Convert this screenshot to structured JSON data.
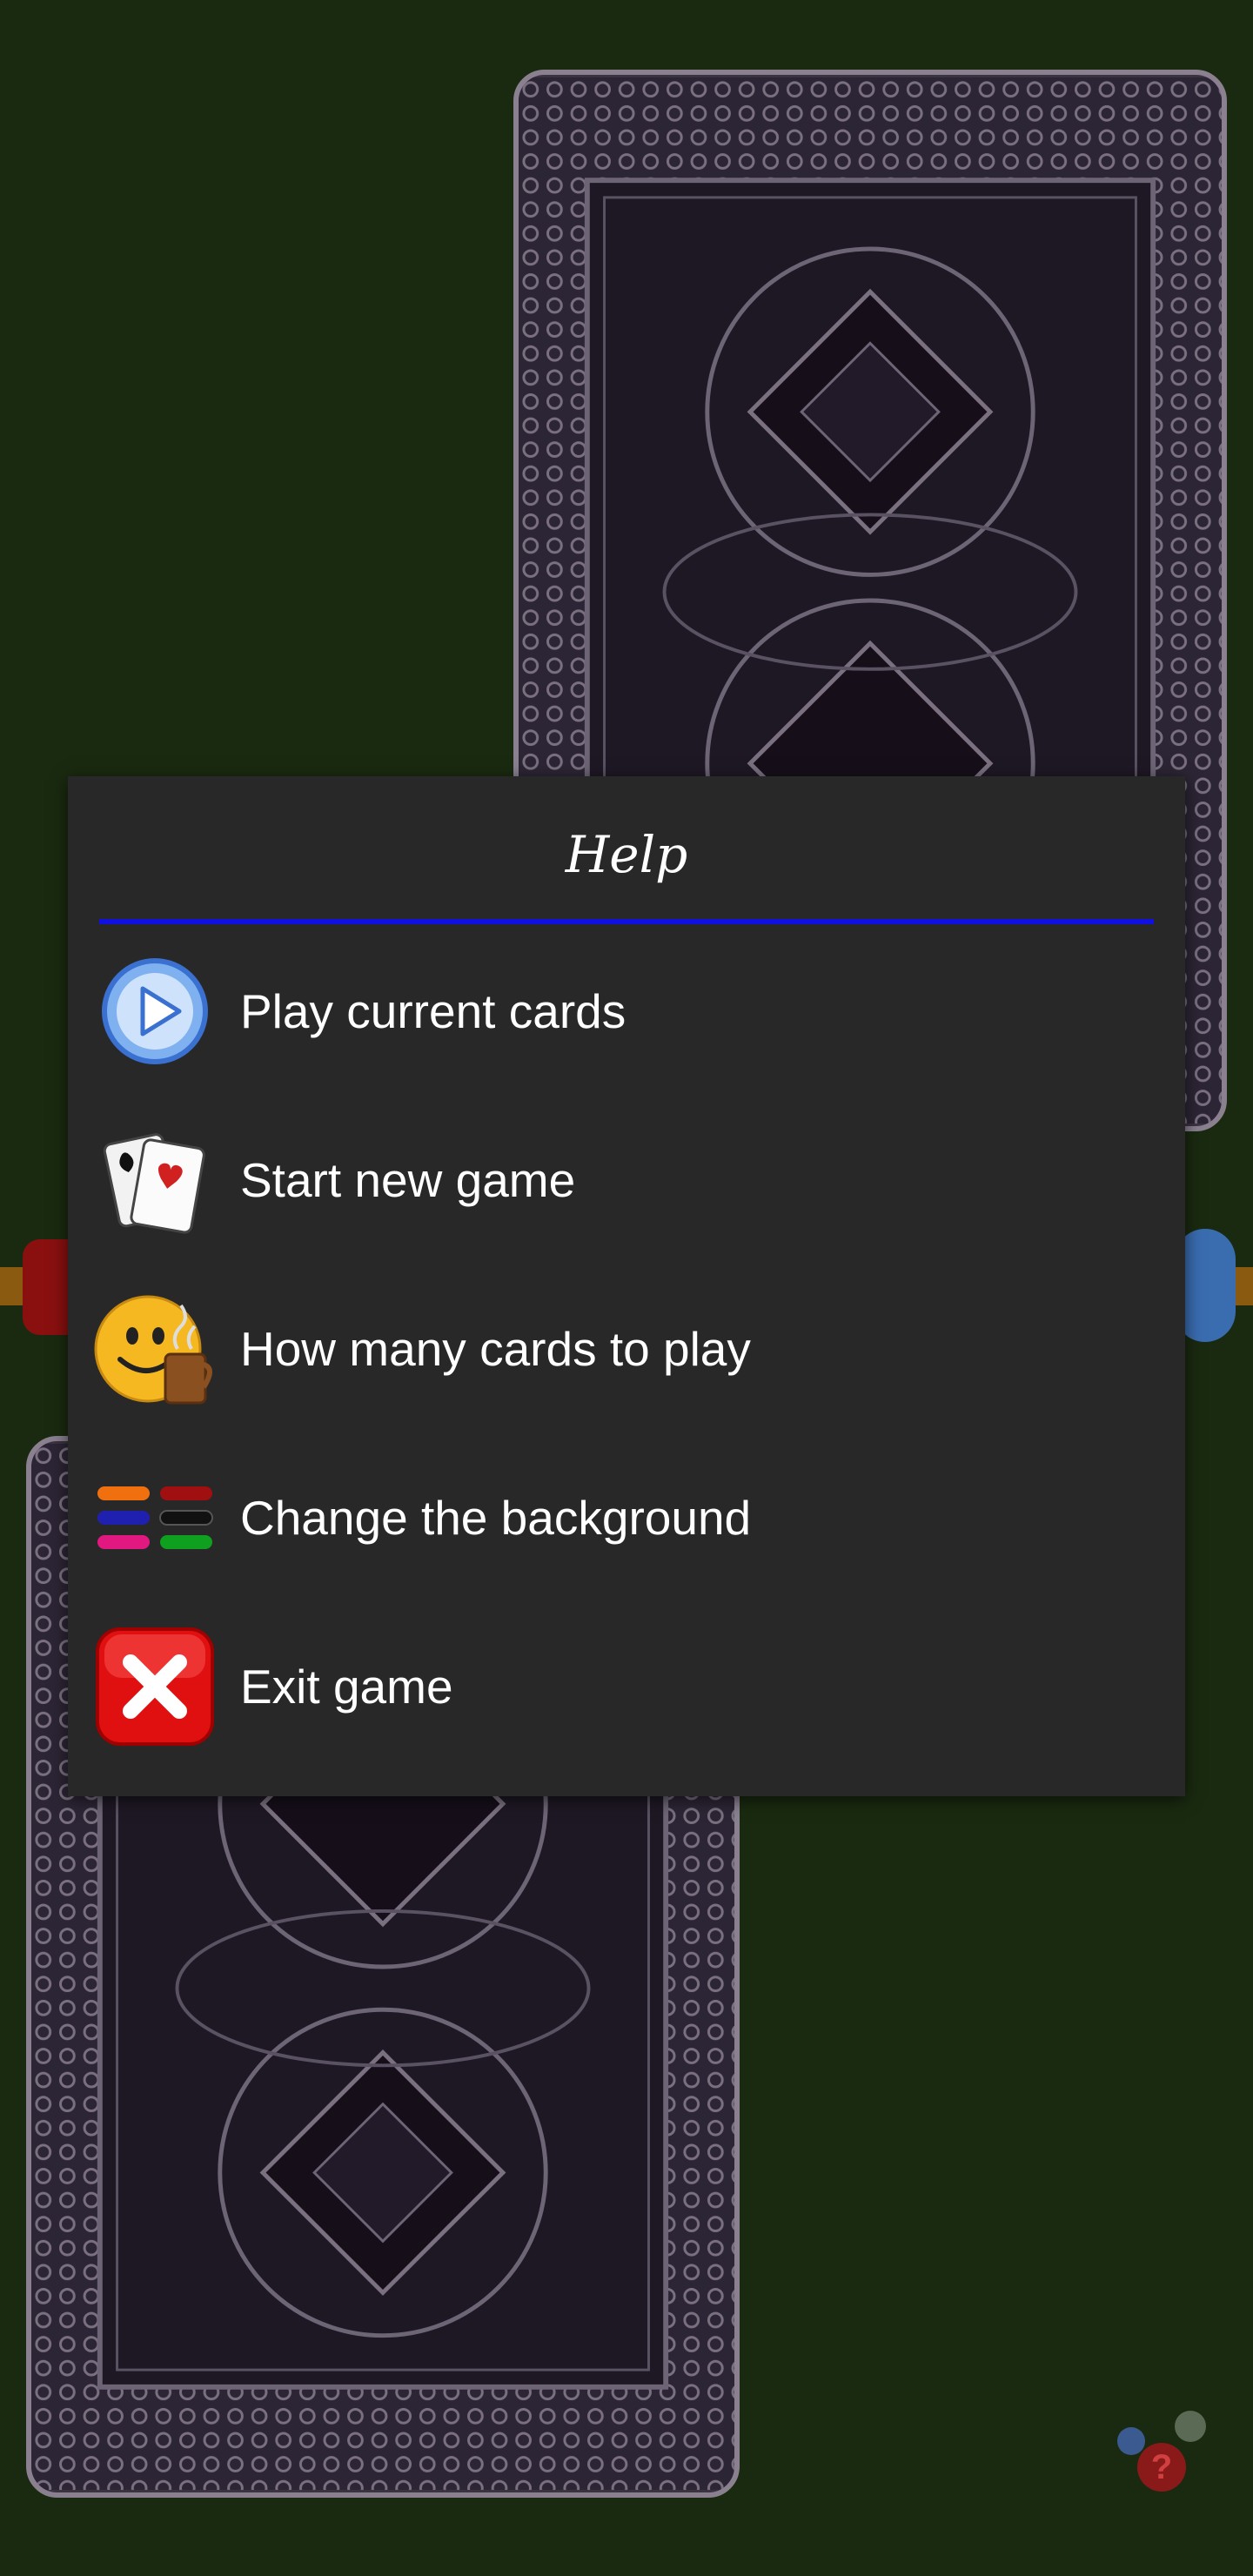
{
  "dialog": {
    "title": "Help",
    "rule_color": "#1010e0",
    "items": [
      {
        "label": "Play current cards",
        "icon": "play-icon"
      },
      {
        "label": "Start new game",
        "icon": "cards-icon"
      },
      {
        "label": "How many cards to play",
        "icon": "smiley-coffee-icon"
      },
      {
        "label": "Change the background",
        "icon": "color-bars-icon"
      },
      {
        "label": "Exit game",
        "icon": "close-icon"
      }
    ]
  },
  "colors": {
    "table_background": "#1a2a10",
    "dialog_background": "#282828",
    "card_back": "#2a2330",
    "exit_red": "#e01010",
    "play_blue": "#7fb0f0"
  }
}
